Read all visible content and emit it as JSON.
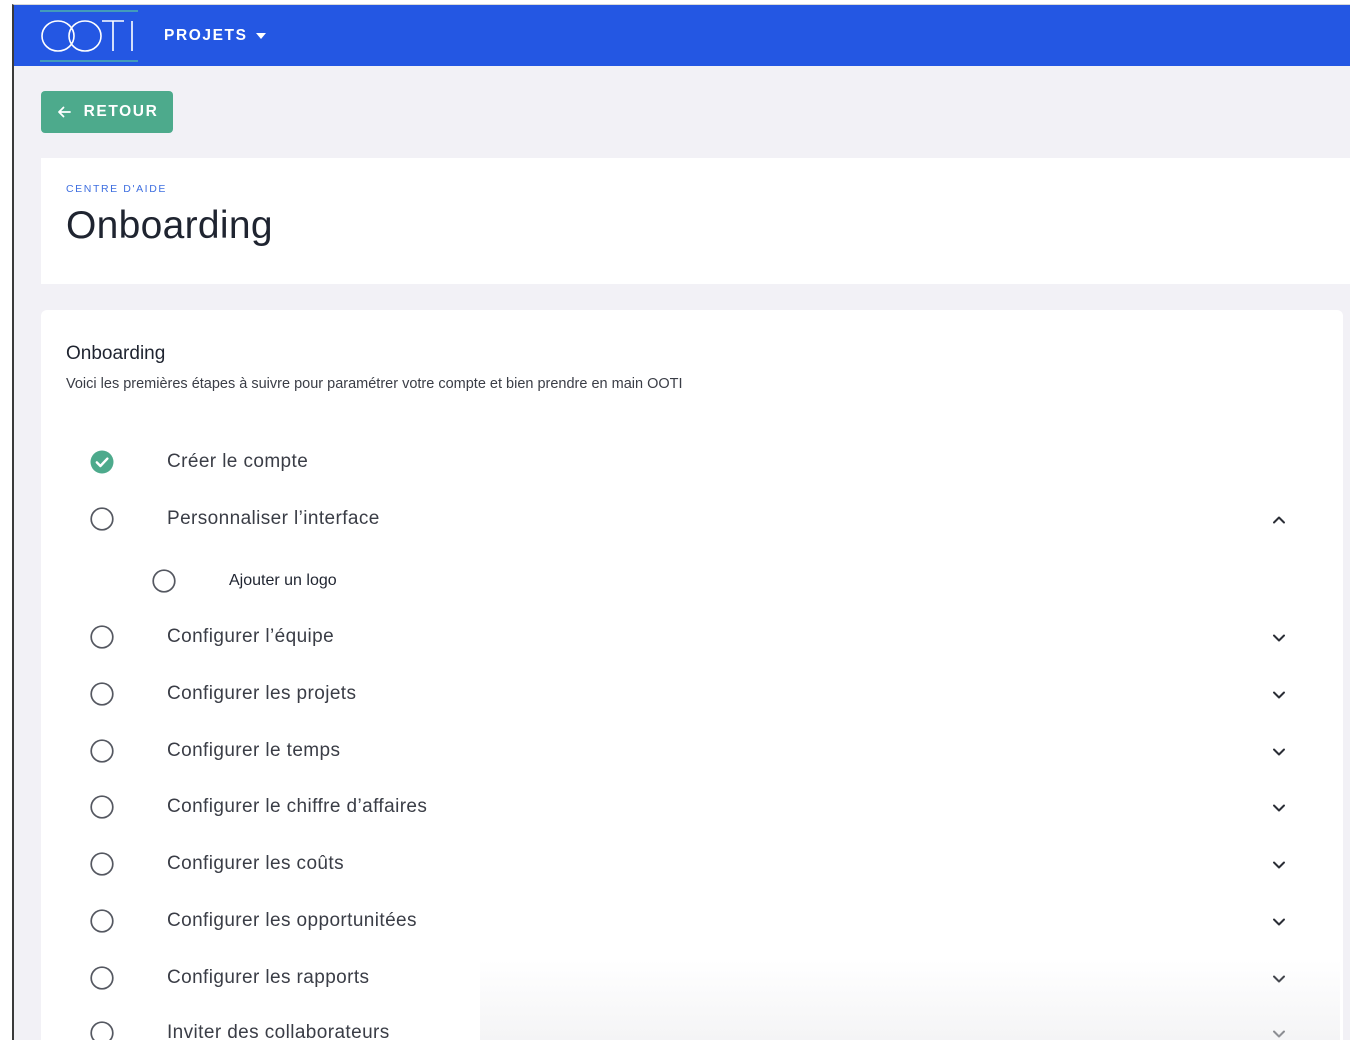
{
  "topbar": {
    "logo_text": "OOTI",
    "projects_label": "PROJETS",
    "brand_color": "#2457e3"
  },
  "back_button": {
    "label": "RETOUR",
    "color": "#4daa8c"
  },
  "header": {
    "breadcrumb": "CENTRE D'AIDE",
    "title": "Onboarding"
  },
  "onboarding": {
    "title": "Onboarding",
    "description": "Voici les premières étapes à suivre pour paramétrer votre compte et bien prendre en main OOTI",
    "steps": [
      {
        "label": "Créer le compte",
        "done": true,
        "chevron": "none"
      },
      {
        "label": "Personnaliser l’interface",
        "done": false,
        "chevron": "chevron-up-icon",
        "substeps": [
          {
            "label": "Ajouter un logo",
            "done": false
          }
        ]
      },
      {
        "label": "Configurer l’équipe",
        "done": false,
        "chevron": "chevron-down-icon"
      },
      {
        "label": "Configurer les projets",
        "done": false,
        "chevron": "chevron-down-icon"
      },
      {
        "label": "Configurer le temps",
        "done": false,
        "chevron": "chevron-down-icon"
      },
      {
        "label": "Configurer le chiffre d’affaires",
        "done": false,
        "chevron": "chevron-down-icon"
      },
      {
        "label": "Configurer les coûts",
        "done": false,
        "chevron": "chevron-down-icon"
      },
      {
        "label": "Configurer les opportunitées",
        "done": false,
        "chevron": "chevron-down-icon"
      },
      {
        "label": "Configurer les rapports",
        "done": false,
        "chevron": "chevron-down-icon"
      },
      {
        "label": "Inviter des collaborateurs",
        "done": false,
        "chevron": "chevron-down-icon"
      }
    ],
    "done_color": "#4daa8c"
  }
}
